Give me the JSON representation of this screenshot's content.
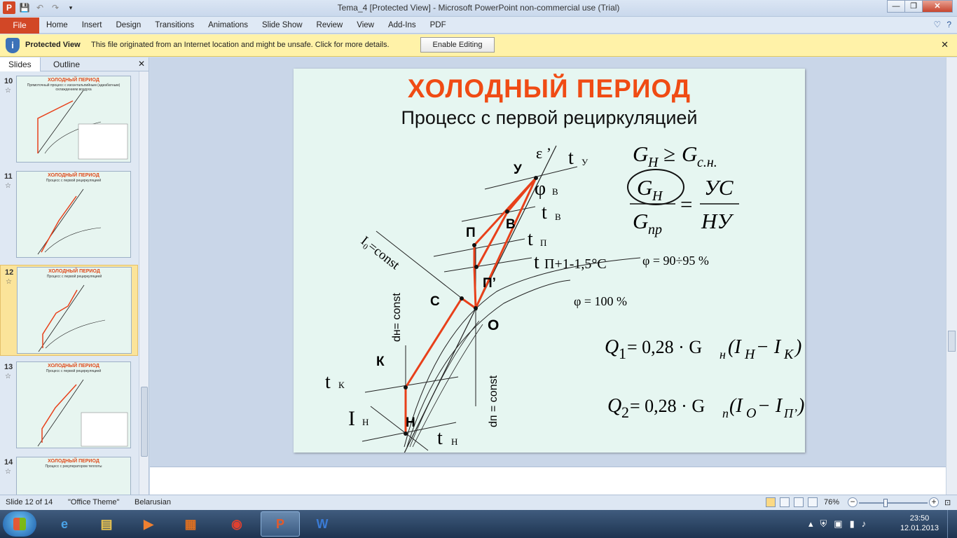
{
  "window": {
    "title": "Tema_4 [Protected View]  -  Microsoft PowerPoint non-commercial use (Trial)",
    "minimize": "—",
    "restore": "❐",
    "close": "✕"
  },
  "ribbon": {
    "file": "File",
    "tabs": [
      "Home",
      "Insert",
      "Design",
      "Transitions",
      "Animations",
      "Slide Show",
      "Review",
      "View",
      "Add-Ins",
      "PDF"
    ]
  },
  "protected_view": {
    "title": "Protected View",
    "message": "This file originated from an Internet location and might be unsafe. Click for more details.",
    "button": "Enable Editing"
  },
  "left_pane": {
    "tab_slides": "Slides",
    "tab_outline": "Outline",
    "slides": [
      {
        "number": "10",
        "title": "ХОЛОДНЫЙ ПЕРИОД",
        "subtitle": "Прямоточный процесс с изоэнтальпийным (адиабатным) охлаждением воздуха"
      },
      {
        "number": "11",
        "title": "ХОЛОДНЫЙ ПЕРИОД",
        "subtitle": "Процесс с первой рециркуляцией"
      },
      {
        "number": "12",
        "title": "ХОЛОДНЫЙ ПЕРИОД",
        "subtitle": "Процесс с первой рециркуляцией"
      },
      {
        "number": "13",
        "title": "ХОЛОДНЫЙ ПЕРИОД",
        "subtitle": "Процесс с первой рециркуляцией"
      },
      {
        "number": "14",
        "title": "ХОЛОДНЫЙ ПЕРИОД",
        "subtitle": "Процесс с рекуператором теплоты"
      }
    ]
  },
  "slide": {
    "title": "ХОЛОДНЫЙ ПЕРИОД",
    "subtitle": "Процесс с первой рециркуляцией",
    "labels": {
      "U": "У",
      "B": "В",
      "P": "П",
      "P2": "П’",
      "C": "С",
      "O": "О",
      "K": "К",
      "H": "Н",
      "eps": "ε ’",
      "tU": "t",
      "tU_sub": "У",
      "phiB": "φ",
      "phiB_sub": "В",
      "tB": "t",
      "tB_sub": "В",
      "tP": "t",
      "tP_sub": "П",
      "tP1": "t",
      "tP1_rest": "П+1-1,5°C",
      "phi9095": "φ = 90÷95 %",
      "phi100": "φ = 100 %",
      "I0": "I₀=const",
      "dH": "dн= const",
      "dP": "dп = const",
      "tK": "t",
      "tK_sub": "К",
      "IH": "I",
      "IH_sub": "Н",
      "tH": "t",
      "tH_sub": "Н"
    },
    "formulas": {
      "cond_lhs": "G",
      "cond_lhs_sub": "Н",
      "cond_op": "≥",
      "cond_rhs": "G",
      "cond_rhs_sub": "с.н.",
      "ratio_num": "G",
      "ratio_num_sub": "Н",
      "ratio_den": "G",
      "ratio_den_sub": "пр",
      "ratio_eq": "=",
      "ratio_rnum": "УС",
      "ratio_rden": "НУ",
      "q1": "Q",
      "q1_sub": "1",
      "q1_body": " = 0,28 · G",
      "q1_gsub": "н",
      "q1_tail": "(I",
      "q1_i1": "Н",
      "q1_minus": " − I",
      "q1_i2": "К",
      "q1_end": ")",
      "q2": "Q",
      "q2_sub": "2",
      "q2_body": " = 0,28 · G",
      "q2_gsub": "п",
      "q2_tail": "(I",
      "q2_i1": "О",
      "q2_minus": " − I",
      "q2_i2": "П’",
      "q2_end": ")"
    }
  },
  "status_bar": {
    "slide_of": "Slide 12 of 14",
    "theme": "\"Office Theme\"",
    "language": "Belarusian",
    "zoom": "76%"
  },
  "taskbar": {
    "time": "23:50",
    "date": "12.01.2013"
  },
  "colors": {
    "accent": "#d24726",
    "slide_title": "#f04b14",
    "process_line": "#e8401a",
    "slide_bg": "#e6f6f1"
  }
}
